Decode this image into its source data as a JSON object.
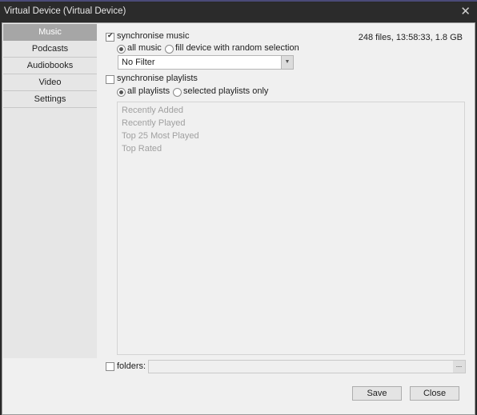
{
  "window": {
    "title": "Virtual Device (Virtual Device)",
    "close_icon": "close-x-icon"
  },
  "sidebar": {
    "items": [
      {
        "label": "Music",
        "active": true
      },
      {
        "label": "Podcasts",
        "active": false
      },
      {
        "label": "Audiobooks",
        "active": false
      },
      {
        "label": "Video",
        "active": false
      },
      {
        "label": "Settings",
        "active": false
      }
    ]
  },
  "music": {
    "sync_music_label": "synchronise music",
    "sync_music_checked": true,
    "info": "248 files, 13:58:33, 1.8 GB",
    "all_music_label": "all music",
    "random_label": "fill device with random selection",
    "selected_mode": "all music",
    "filter_value": "No Filter",
    "sync_playlists_label": "synchronise playlists",
    "sync_playlists_checked": false,
    "all_playlists_label": "all playlists",
    "selected_playlists_label": "selected playlists only",
    "selected_playlist_mode": "all playlists",
    "playlists": [
      "Recently Added",
      "Recently Played",
      "Top 25 Most Played",
      "Top Rated"
    ],
    "folders_label": "folders:",
    "folders_checked": false,
    "folders_value": "",
    "browse_label": "..."
  },
  "buttons": {
    "save": "Save",
    "close": "Close"
  }
}
